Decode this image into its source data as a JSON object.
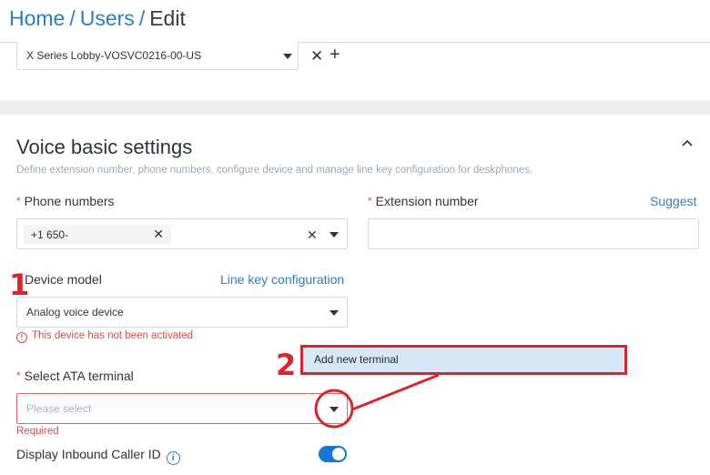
{
  "breadcrumb": {
    "home": "Home",
    "users": "Users",
    "current": "Edit",
    "separator": "/"
  },
  "location_select": {
    "value": "X Series Lobby-VOSVC0216-00-US",
    "clear_glyph": "✕",
    "add_glyph": "+"
  },
  "voice_section": {
    "title": "Voice basic settings",
    "description": "Define extension number, phone numbers, configure device and manage line key configuration for deskphones.",
    "collapse_icon": "chevron-up-icon"
  },
  "phone_numbers": {
    "label": "Phone numbers",
    "required_mark": "*",
    "tag_value": "+1 650-",
    "tag_remove_glyph": "✕",
    "clear_glyph": "✕"
  },
  "extension_number": {
    "label": "Extension number",
    "required_mark": "*",
    "suggest_link": "Suggest",
    "value": ""
  },
  "device_model": {
    "label": "Device model",
    "line_key_link": "Line key configuration",
    "value": "Analog voice device",
    "error_icon_glyph": "!",
    "error": "This device has not been activated"
  },
  "ata_terminal": {
    "label": "Select ATA terminal",
    "required_mark": "*",
    "placeholder": "Please select",
    "validation": "Required"
  },
  "caller_id": {
    "label": "Display Inbound Caller ID",
    "info_glyph": "i",
    "enabled": true
  },
  "dropdown": {
    "options": [
      "Add new terminal"
    ]
  },
  "annotations": {
    "step1": "1",
    "step2": "2",
    "color": "#d9262c"
  },
  "colors": {
    "link": "#2e7dc4",
    "error": "#e04747",
    "toggle_on": "#1577d4",
    "highlight": "#d6e8f7"
  }
}
